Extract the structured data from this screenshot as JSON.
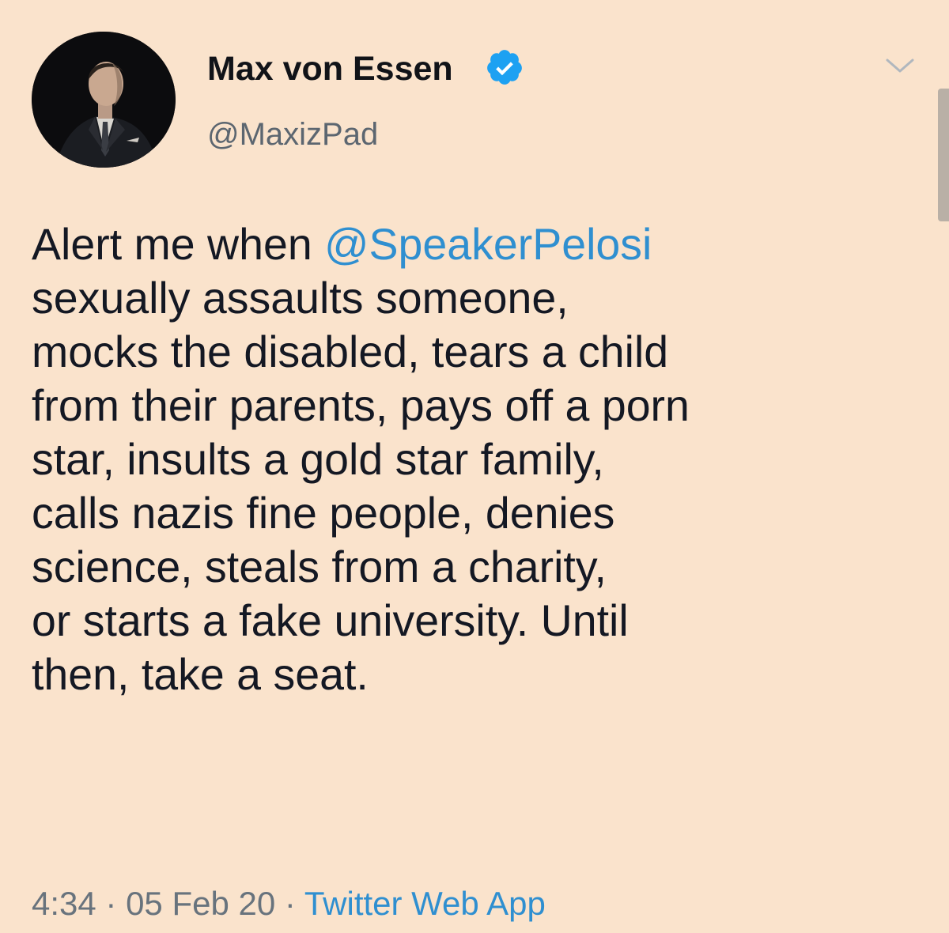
{
  "author": {
    "display_name": "Max von Essen",
    "handle": "@MaxizPad",
    "verified": true,
    "avatar_icon": "profile-photo"
  },
  "tweet": {
    "lines": [
      {
        "prefix": "Alert me when ",
        "mention": "@SpeakerPelosi"
      },
      {
        "text": "sexually assaults someone,"
      },
      {
        "text": "mocks the disabled, tears a child"
      },
      {
        "text": "from their parents, pays off a porn"
      },
      {
        "text": "star, insults a gold star family,"
      },
      {
        "text": "calls nazis fine people, denies"
      },
      {
        "text": "science, steals from a charity,"
      },
      {
        "text": "or starts a fake university. Until"
      },
      {
        "text": "then, take a seat."
      }
    ]
  },
  "meta": {
    "time": "4:34",
    "separator1": " · ",
    "date": "05 Feb 20",
    "separator2": " · ",
    "source": "Twitter Web App"
  },
  "icons": {
    "verified": "verified-badge-icon",
    "menu": "chevron-down-icon"
  },
  "colors": {
    "background": "#fae3cc",
    "text": "#141823",
    "link": "#2f8fd0",
    "secondary": "#5c6670",
    "verified": "#1da1f2"
  }
}
